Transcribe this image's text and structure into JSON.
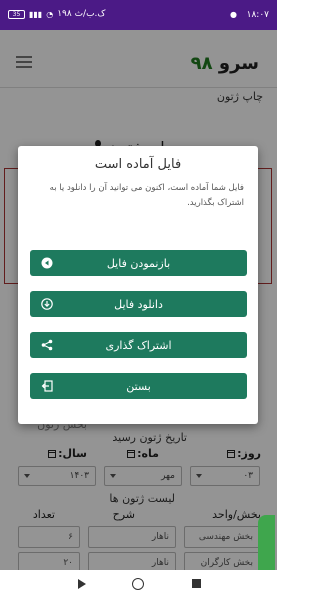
{
  "status_bar": {
    "time": "۱۸:۰۷",
    "speed": "۱۹۸ ک.ب/ث",
    "battery": "35"
  },
  "app_bar": {
    "brand_text": "سرو",
    "brand_num": "۹۸"
  },
  "page": {
    "breadcrumb": "چاپ ژتون",
    "title": "چاپ ژتون",
    "date_section": "تاریخ ژتون رسید",
    "day_label": "روز:",
    "month_label": "ماه:",
    "year_label": "سال:",
    "day_value": "۰۳",
    "month_value": "مهر",
    "year_value": "۱۴۰۳",
    "list_title": "لیست ژتون ها",
    "col_section": "بخش/واحد",
    "col_desc": "شرح",
    "col_count": "تعداد",
    "rows": [
      {
        "section": "بخش مهندسی",
        "desc": "ناهار",
        "count": "۶"
      },
      {
        "section": "بخش کارگران",
        "desc": "ناهار",
        "count": "۲۰"
      }
    ],
    "faded_text": "بخش ژتون"
  },
  "dialog": {
    "title": "فایل آماده است",
    "message": "فایل شما آماده است، اکنون می توانید آن را دانلود یا به اشتراک بگذارید.",
    "buttons": [
      {
        "label": "بازنمودن فایل",
        "icon": "play-circle-icon"
      },
      {
        "label": "دانلود فایل",
        "icon": "download-icon"
      },
      {
        "label": "اشتراک گذاری",
        "icon": "share-icon"
      },
      {
        "label": "بستن",
        "icon": "exit-icon"
      }
    ],
    "accent": "#1e7a5e"
  },
  "colors": {
    "status_bar": "#4b1a86",
    "brand_green": "#1f7a1f"
  }
}
